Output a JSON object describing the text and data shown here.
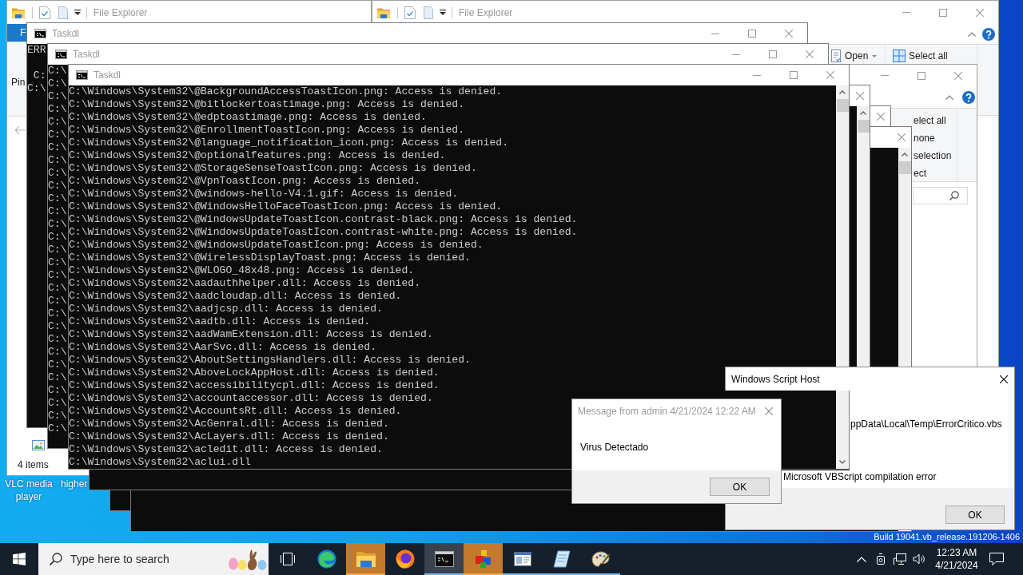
{
  "desktop": {
    "icons": [
      {
        "label": "VLC media player"
      },
      {
        "label": "higher"
      }
    ],
    "build_info": "Build 19041.vb_release.191206-1406"
  },
  "explorer_left": {
    "title": "File Explorer",
    "active": false,
    "file_tab": "F",
    "ribbon_items": [
      "Pin"
    ],
    "status_bar": "4 items"
  },
  "explorer_right": {
    "title": "File Explorer",
    "active": false,
    "ribbon_items": [
      {
        "label": "Open",
        "kind": "dropdown"
      },
      {
        "label": "Select all",
        "kind": "button"
      }
    ]
  },
  "explorer_small": {
    "active": false,
    "ribbon_items": [
      "elect all",
      "none",
      "selection",
      "ect"
    ]
  },
  "console_windows": [
    {
      "title": "Taskdl",
      "active": false,
      "output_blocks": [
        [
          "ERR"
        ],
        [
          " C:",
          "C:\\"
        ]
      ]
    },
    {
      "title": "Taskdl",
      "active": false,
      "output_blocks": [
        [
          "C:\\",
          "C:\\",
          "C:\\",
          "C:\\",
          "C:\\",
          "C:\\",
          "C:\\",
          "C:\\",
          "C:\\",
          "C:\\",
          "C:\\",
          "C:\\",
          "C:\\",
          "C:\\",
          "C:\\",
          "C:\\",
          "C:\\",
          "C:\\",
          "C:\\",
          "C:\\",
          "C:\\",
          "C:\\",
          "C:\\",
          "C:\\",
          "C:\\",
          "C:\\",
          "C:\\",
          "C:\\",
          "C:\\"
        ]
      ]
    },
    {
      "title": "Taskdl",
      "active": false,
      "output_blocks": [
        [
          "C:\\Windows\\System32\\@BackgroundAccessToastIcon.png: Access is denied.",
          "C:\\Windows\\System32\\@bitlockertoastimage.png: Access is denied.",
          "C:\\Windows\\System32\\@edptoastimage.png: Access is denied.",
          "C:\\Windows\\System32\\@EnrollmentToastIcon.png: Access is denied.",
          "C:\\Windows\\System32\\@language_notification_icon.png: Access is denied.",
          "C:\\Windows\\System32\\@optionalfeatures.png: Access is denied.",
          "C:\\Windows\\System32\\@StorageSenseToastIcon.png: Access is denied.",
          "C:\\Windows\\System32\\@VpnToastIcon.png: Access is denied.",
          "C:\\Windows\\System32\\@windows-hello-V4.1.gif: Access is denied.",
          "C:\\Windows\\System32\\@WindowsHelloFaceToastIcon.png: Access is denied.",
          "C:\\Windows\\System32\\@WindowsUpdateToastIcon.contrast-black.png: Access is denied.",
          "C:\\Windows\\System32\\@WindowsUpdateToastIcon.contrast-white.png: Access is denied.",
          "C:\\Windows\\System32\\@WindowsUpdateToastIcon.png: Access is denied.",
          "C:\\Windows\\System32\\@WirelessDisplayToast.png: Access is denied.",
          "C:\\Windows\\System32\\@WLOGO_48x48.png: Access is denied.",
          "C:\\Windows\\System32\\aadauthhelper.dll: Access is denied.",
          "C:\\Windows\\System32\\aadcloudap.dll: Access is denied.",
          "C:\\Windows\\System32\\aadjcsp.dll: Access is denied.",
          "C:\\Windows\\System32\\aadtb.dll: Access is denied.",
          "C:\\Windows\\System32\\aadWamExtension.dll: Access is denied.",
          "C:\\Windows\\System32\\AarSvc.dll: Access is denied.",
          "C:\\Windows\\System32\\AboutSettingsHandlers.dll: Access is denied.",
          "C:\\Windows\\System32\\AboveLockAppHost.dll: Access is denied.",
          "C:\\Windows\\System32\\accessibilitycpl.dll: Access is denied.",
          "C:\\Windows\\System32\\accountaccessor.dll: Access is denied.",
          "C:\\Windows\\System32\\AccountsRt.dll: Access is denied.",
          "C:\\Windows\\System32\\AcGenral.dll: Access is denied.",
          "C:\\Windows\\System32\\AcLayers.dll: Access is denied.",
          "C:\\Windows\\System32\\acledit.dll: Access is denied.",
          "C:\\Windows\\System32\\aclui.dll"
        ]
      ]
    },
    {
      "active": false
    },
    {
      "active": false
    },
    {
      "active": false
    }
  ],
  "script_host_dialog": {
    "title": "Windows Script Host",
    "active": true,
    "lines": [
      "ppData\\Local\\Temp\\ErrorCritico.vbs",
      "Microsoft VBScript compilation error"
    ],
    "buttons": [
      "OK"
    ]
  },
  "message_dialog": {
    "title": "Message from admin 4/21/2024 12:22 AM",
    "active": false,
    "message": "Virus Detectado",
    "buttons": [
      "OK"
    ]
  },
  "taskbar": {
    "search": {
      "placeholder": "Type here to search"
    },
    "apps": [
      {
        "running": false,
        "flashing": false,
        "active": false
      },
      {
        "running": true,
        "flashing": true,
        "active": false
      },
      {
        "running": false,
        "flashing": false,
        "active": false
      },
      {
        "running": true,
        "flashing": false,
        "active": true
      },
      {
        "running": true,
        "flashing": true,
        "active": false
      },
      {
        "running": true,
        "flashing": false,
        "active": false
      },
      {
        "running": true,
        "flashing": false,
        "active": false
      },
      {
        "running": true,
        "flashing": false,
        "active": false
      }
    ],
    "clock": {
      "time": "12:23 AM",
      "date": "4/21/2024"
    }
  }
}
